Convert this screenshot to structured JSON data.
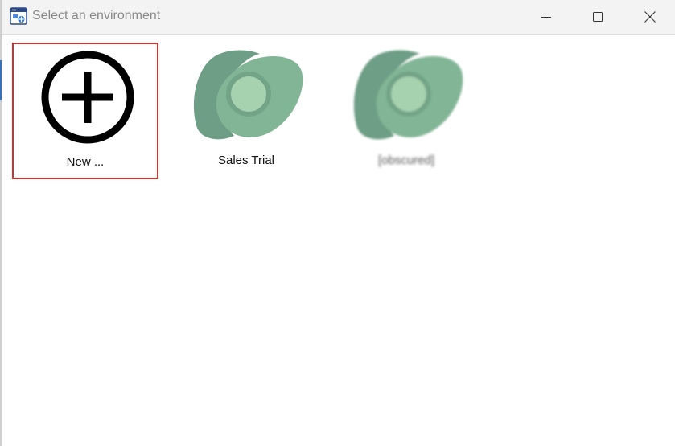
{
  "window": {
    "title": "Select an environment",
    "controls": {
      "minimize": "minimize",
      "maximize": "maximize",
      "close": "close"
    }
  },
  "environments": [
    {
      "label": "New ...",
      "icon": "add-circle-icon",
      "selected": true
    },
    {
      "label": "Sales Trial",
      "icon": "dataverse-logo-icon",
      "selected": false
    },
    {
      "label": "[obscured]",
      "icon": "dataverse-logo-icon",
      "selected": false,
      "obscured": true
    }
  ],
  "colors": {
    "selection_border": "#d32f2f",
    "logo_dark": "#6e9e85",
    "logo_mid": "#82b596",
    "logo_light": "#a7d2af"
  }
}
